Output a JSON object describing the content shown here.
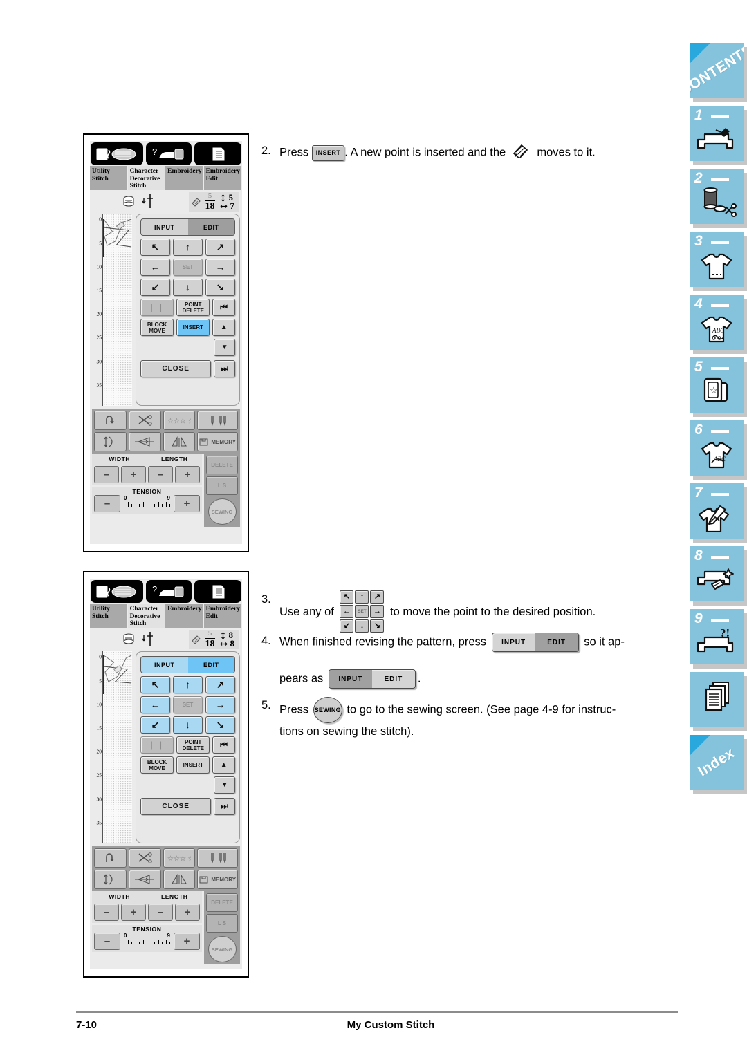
{
  "footer": {
    "page_number": "7-10",
    "chapter_title": "My Custom Stitch"
  },
  "steps": {
    "s2": {
      "num": "2.",
      "t1": "Press",
      "t2": ". A new point is inserted and the",
      "t3": "moves to it.",
      "button": "INSERT"
    },
    "s3": {
      "num": "3.",
      "t1": "Use any of",
      "t2": "to move the point to the desired position.",
      "pad": [
        "↖",
        "↑",
        "↗",
        "←",
        "SET",
        "→",
        "↙",
        "↓",
        "↘"
      ]
    },
    "s4": {
      "num": "4.",
      "t1": "When finished revising the pattern, press",
      "t2": "so it ap-",
      "t3": "pears as",
      "t4": ".",
      "btn_a": {
        "left": "INPUT",
        "right": "EDIT",
        "selected": "EDIT"
      },
      "btn_b": {
        "left": "INPUT",
        "right": "EDIT",
        "selected": "INPUT"
      }
    },
    "s5": {
      "num": "5.",
      "t1": "Press",
      "t2": "to go to the sewing screen. (See page 4-9 for instruc-",
      "t3": "tions on sewing the stitch).",
      "button": "SEWING"
    }
  },
  "sidebar": {
    "tabs": [
      {
        "name": "contents",
        "label": "CONTENTS",
        "number": "",
        "icon": "text-corner",
        "corner": true
      },
      {
        "name": "chapter-1",
        "label": "",
        "number": "1",
        "icon": "sewing-machine-icon"
      },
      {
        "name": "chapter-2",
        "label": "",
        "number": "2",
        "icon": "thread-spool-scissors-icon"
      },
      {
        "name": "chapter-3",
        "label": "",
        "number": "3",
        "icon": "tshirt-stitch-icon"
      },
      {
        "name": "chapter-4",
        "label": "",
        "number": "4",
        "icon": "tshirt-abc-icon"
      },
      {
        "name": "chapter-5",
        "label": "",
        "number": "5",
        "icon": "embroidery-card-star-icon"
      },
      {
        "name": "chapter-6",
        "label": "",
        "number": "6",
        "icon": "tshirt-letters-icon"
      },
      {
        "name": "chapter-7",
        "label": "",
        "number": "7",
        "icon": "tshirt-pen-icon"
      },
      {
        "name": "chapter-8",
        "label": "",
        "number": "8",
        "icon": "machine-cleaning-icon"
      },
      {
        "name": "chapter-9",
        "label": "",
        "number": "9",
        "icon": "machine-question-icon"
      },
      {
        "name": "appendix",
        "label": "",
        "number": "",
        "icon": "pages-stack-icon"
      },
      {
        "name": "index",
        "label": "Index",
        "number": "",
        "icon": "text-corner",
        "corner": true
      }
    ],
    "accent_color": "#85c3dc",
    "corner_color": "#29a8de"
  },
  "lcd": {
    "tabs": [
      {
        "label": "Utility\nStitch",
        "active": false
      },
      {
        "label": "Character\nDecorative\nStitch",
        "active": true
      },
      {
        "label": "Embroidery",
        "active": false
      },
      {
        "label": "Embroidery\nEdit",
        "active": false
      }
    ],
    "icon_buttons": [
      "needle-thread-icon",
      "machine-help-icon",
      "settings-list-icon"
    ],
    "keypad": {
      "input": "INPUT",
      "edit": "EDIT",
      "set": "SET",
      "point_delete": "POINT\nDELETE",
      "block_move": "BLOCK\nMOVE",
      "insert": "INSERT",
      "close": "CLOSE",
      "arrows": [
        "↖",
        "↑",
        "↗",
        "←",
        "SET",
        "→",
        "↙",
        "↓",
        "↘"
      ],
      "nav": [
        "↥",
        "▲",
        "▼",
        "↧"
      ]
    },
    "ruler_ticks": [
      "0",
      "5",
      "10",
      "15",
      "20",
      "25",
      "30",
      "35"
    ],
    "function_labels": {
      "memory": "MEMORY",
      "delete": "DELETE",
      "ls": "L  S",
      "sewing": "SEWING"
    },
    "adjust": {
      "width": "WIDTH",
      "length": "LENGTH",
      "tension": "TENSION",
      "tension_min": "0",
      "tension_max": "9",
      "minus": "–",
      "plus": "+"
    }
  },
  "screens": [
    {
      "name": "screen-insert-highlighted",
      "counter": {
        "current": "5",
        "total": "18",
        "height": "5",
        "width": "7"
      },
      "mode_selected": "EDIT",
      "keys_blue": false,
      "insert_highlighted": true
    },
    {
      "name": "screen-point-moved",
      "counter": {
        "current": "5",
        "total": "18",
        "height": "8",
        "width": "8"
      },
      "mode_selected": "EDIT",
      "keys_blue": true,
      "insert_highlighted": false
    }
  ]
}
